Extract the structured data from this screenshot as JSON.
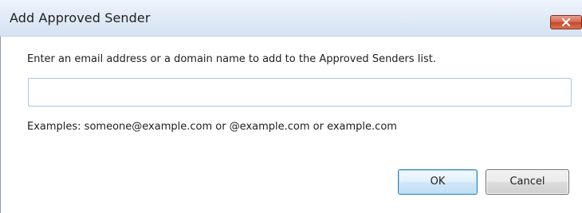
{
  "window": {
    "title": "Add Approved Sender",
    "close_icon": "close-x-icon"
  },
  "form": {
    "prompt": "Enter an email address or a domain name to add to the Approved Senders list.",
    "input_value": "",
    "input_placeholder": "",
    "examples": "Examples:  someone@example.com or @example.com or example.com"
  },
  "buttons": {
    "ok_label": "OK",
    "cancel_label": "Cancel"
  },
  "colors": {
    "titlebar": "#dfe9f6",
    "close_button": "#c2482f",
    "input_border": "#a9c7e6",
    "ok_border": "#3c7fb1"
  }
}
